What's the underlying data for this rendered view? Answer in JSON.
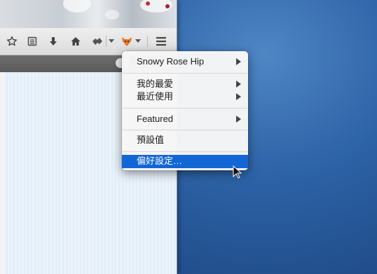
{
  "menu": {
    "items": [
      {
        "label": "Snowy Rose Hip",
        "has_submenu": true
      },
      {
        "label": "我的最愛",
        "has_submenu": true
      },
      {
        "label": "最近使用",
        "has_submenu": true
      },
      {
        "label": "Featured",
        "has_submenu": true
      },
      {
        "label": "預設值",
        "has_submenu": false
      },
      {
        "label": "偏好設定…",
        "has_submenu": false,
        "highlighted": true
      }
    ]
  },
  "toolbar": {
    "icons": [
      "star-icon",
      "reading-list-icon",
      "download-icon",
      "home-icon",
      "addon-icon",
      "dropdown-icon",
      "fox-theme-icon",
      "dropdown-icon",
      "hamburger-menu-icon"
    ]
  },
  "colors": {
    "highlight": "#1266d6",
    "desktop": "#2c62a6"
  }
}
